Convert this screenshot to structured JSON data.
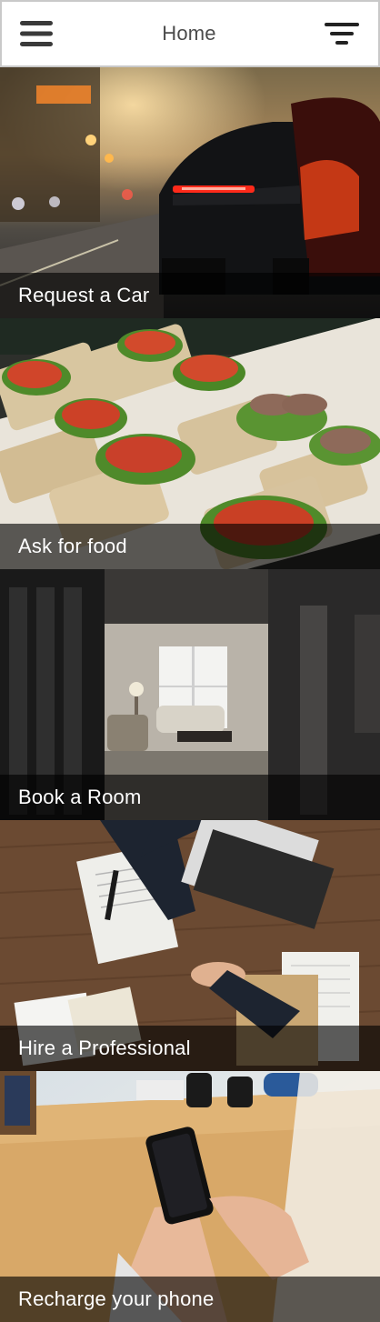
{
  "header": {
    "title": "Home",
    "menu_icon": "hamburger-menu-icon",
    "filter_icon": "filter-icon"
  },
  "tiles": [
    {
      "label": "Request a Car",
      "image": "sports-car-street-photo"
    },
    {
      "label": "Ask for food",
      "image": "sandwiches-photo"
    },
    {
      "label": "Book a Room",
      "image": "hotel-room-photo"
    },
    {
      "label": "Hire a Professional",
      "image": "business-handshake-photo"
    },
    {
      "label": "Recharge your phone",
      "image": "hand-holding-phone-photo"
    }
  ]
}
